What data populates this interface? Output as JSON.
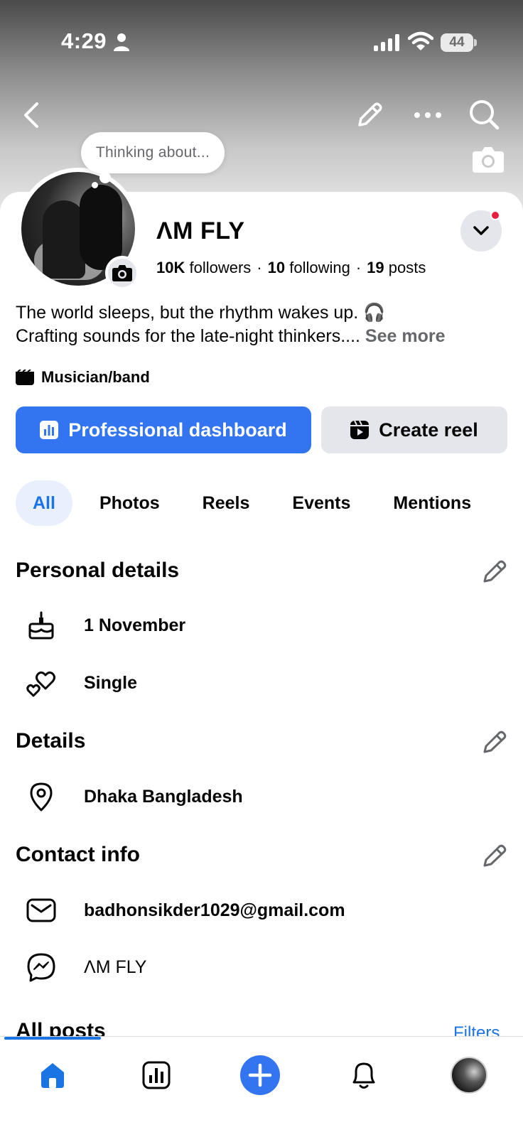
{
  "status_bar": {
    "time": "4:29",
    "battery": "44"
  },
  "thought_bubble": "Thinking about...",
  "profile": {
    "name": "ΛM FLY",
    "followers_count": "10K",
    "followers_label": "followers",
    "following_count": "10",
    "following_label": "following",
    "posts_count": "19",
    "posts_label": "posts",
    "bio_line1": "The world sleeps, but the rhythm wakes up. 🎧",
    "bio_line2": "Crafting sounds for the late-night thinkers.... ",
    "see_more": "See more",
    "category": "Musician/band"
  },
  "buttons": {
    "professional_dashboard": "Professional dashboard",
    "create_reel": "Create reel"
  },
  "tabs": [
    {
      "label": "All",
      "active": true
    },
    {
      "label": "Photos",
      "active": false
    },
    {
      "label": "Reels",
      "active": false
    },
    {
      "label": "Events",
      "active": false
    },
    {
      "label": "Mentions",
      "active": false
    }
  ],
  "personal_details": {
    "title": "Personal details",
    "birthday": "1 November",
    "relationship": "Single"
  },
  "details": {
    "title": "Details",
    "location": "Dhaka Bangladesh"
  },
  "contact_info": {
    "title": "Contact info",
    "email": "badhonsikder1029@gmail.com",
    "messenger": "ΛM FLY"
  },
  "all_posts": {
    "title": "All posts",
    "filters": "Filters"
  },
  "colors": {
    "primary": "#3374f1",
    "link": "#1b74e4",
    "tab_active_bg": "#e8f0fd",
    "notification": "#e41e3f"
  },
  "icons": {
    "bottom_nav": [
      "home-icon",
      "dashboard-icon",
      "create-icon",
      "notifications-icon",
      "profile-avatar"
    ]
  }
}
